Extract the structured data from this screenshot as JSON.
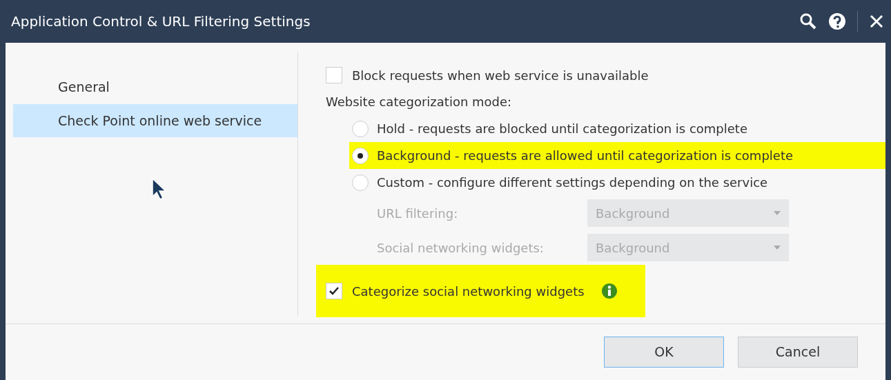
{
  "window": {
    "title": "Application Control & URL Filtering Settings"
  },
  "sidebar": {
    "items": [
      {
        "label": "General",
        "selected": false
      },
      {
        "label": "Check Point online web service",
        "selected": true
      }
    ]
  },
  "block_unavailable": {
    "label": "Block requests when web service is unavailable",
    "checked": false,
    "highlighted": false
  },
  "mode": {
    "label": "Website categorization mode:",
    "options": [
      {
        "label": "Hold - requests are blocked until categorization is complete",
        "selected": false,
        "highlighted": false
      },
      {
        "label": "Background - requests are allowed until categorization is complete",
        "selected": true,
        "highlighted": true
      },
      {
        "label": "Custom - configure different settings depending on the service",
        "selected": false,
        "highlighted": false
      }
    ]
  },
  "custom_settings": [
    {
      "label": "URL filtering:",
      "value": "Background",
      "disabled": true
    },
    {
      "label": "Social networking widgets:",
      "value": "Background",
      "disabled": true
    }
  ],
  "categorize_widgets": {
    "label": "Categorize social networking widgets",
    "checked": true,
    "highlighted": true
  },
  "buttons": [
    {
      "label": "OK",
      "default": true
    },
    {
      "label": "Cancel",
      "default": false
    }
  ]
}
